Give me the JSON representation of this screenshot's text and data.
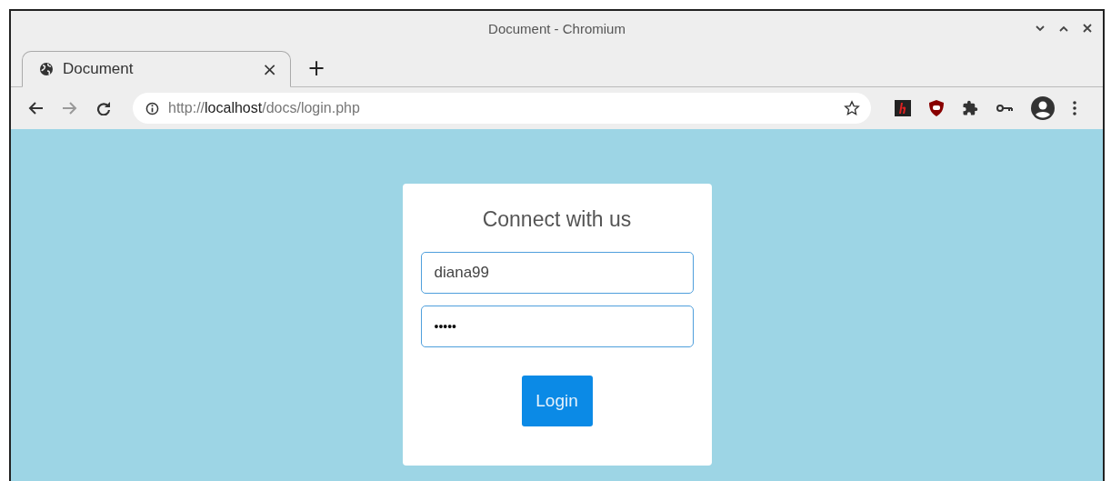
{
  "window": {
    "title": "Document - Chromium"
  },
  "tabs": [
    {
      "label": "Document",
      "selected": true,
      "close": "×"
    }
  ],
  "new_tab": "+",
  "address_bar": {
    "scheme": "http://",
    "host": "localhost",
    "path": "/docs/login.php"
  },
  "login_card": {
    "heading": "Connect with us",
    "fields": [
      {
        "kind": "text",
        "value": "diana99"
      },
      {
        "kind": "password",
        "value": "•••••"
      }
    ],
    "button": "Login"
  }
}
